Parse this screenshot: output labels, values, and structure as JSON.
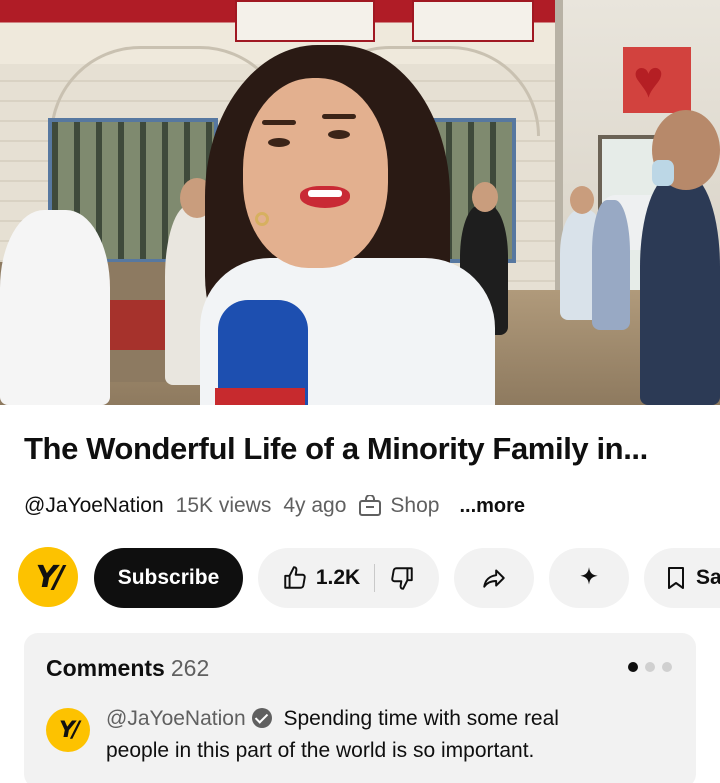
{
  "video": {
    "title": "The Wonderful Life of a Minority Family in..."
  },
  "meta": {
    "channel_handle": "@JaYoeNation",
    "views": "15K views",
    "age": "4y ago",
    "shop_label": "Shop",
    "more_label": "...more"
  },
  "actions": {
    "avatar_mark": "Y/",
    "subscribe_label": "Subscribe",
    "like_count": "1.2K",
    "save_label": "Sa"
  },
  "comments": {
    "heading": "Comments",
    "count": "262",
    "top_comment": {
      "author": "@JaYoeNation",
      "text": "Spending time with some real people in this part of the world is so important."
    },
    "pager": {
      "total": 3,
      "active": 1
    }
  },
  "colors": {
    "brand_yellow": "#fdc200",
    "subscribe_bg": "#0f0f0f",
    "pill_bg": "#f2f2f2",
    "secondary_text": "#606060"
  },
  "icons": [
    "shop-icon",
    "thumbs-up-icon",
    "thumbs-down-icon",
    "share-icon",
    "sparkle-icon",
    "bookmark-icon",
    "verified-check-icon"
  ]
}
